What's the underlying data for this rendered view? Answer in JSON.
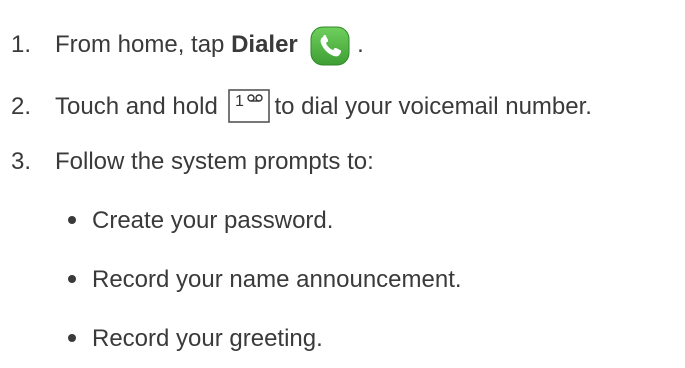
{
  "steps": [
    {
      "num": "1.",
      "pre": "From home, tap ",
      "bold": "Dialer",
      "post": " ."
    },
    {
      "num": "2.",
      "pre": "Touch and hold",
      "post": "to dial your voicemail number."
    },
    {
      "num": "3.",
      "text": "Follow the system prompts to:"
    }
  ],
  "bullets": [
    "Create your password.",
    "Record your name announcement.",
    "Record your greeting."
  ],
  "icons": {
    "dialer": "dialer-phone-icon",
    "key": "voicemail-key-1-icon",
    "key_label": "1",
    "dialer_color": "#4caf3f"
  }
}
